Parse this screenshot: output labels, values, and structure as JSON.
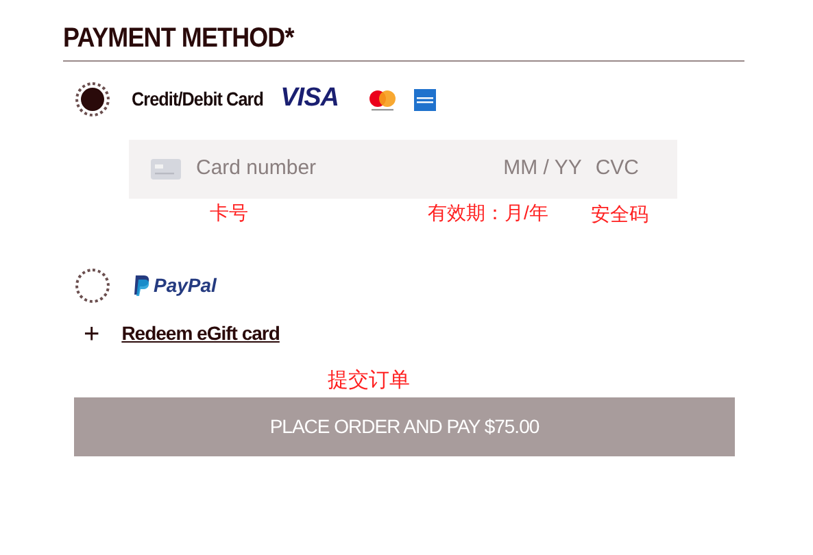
{
  "title": "PAYMENT METHOD*",
  "methods": [
    {
      "kind": "card",
      "label": "Credit/Debit Card",
      "logo": "VISA",
      "selected": true
    },
    {
      "kind": "paypal",
      "logo": "PayPal",
      "selected": false
    }
  ],
  "card_field": {
    "number_placeholder": "Card number",
    "expiry_placeholder": "MM / YY",
    "cvc_placeholder": "CVC"
  },
  "card_notes": [
    "卡号",
    "有效期：月/年",
    "安全码"
  ],
  "gift_link": {
    "icon": "+",
    "label": "Redeem eGift card"
  },
  "order_note": "提交订单",
  "order_button": {
    "label": "PLACE ORDER AND PAY $75.00",
    "disabled": true
  }
}
